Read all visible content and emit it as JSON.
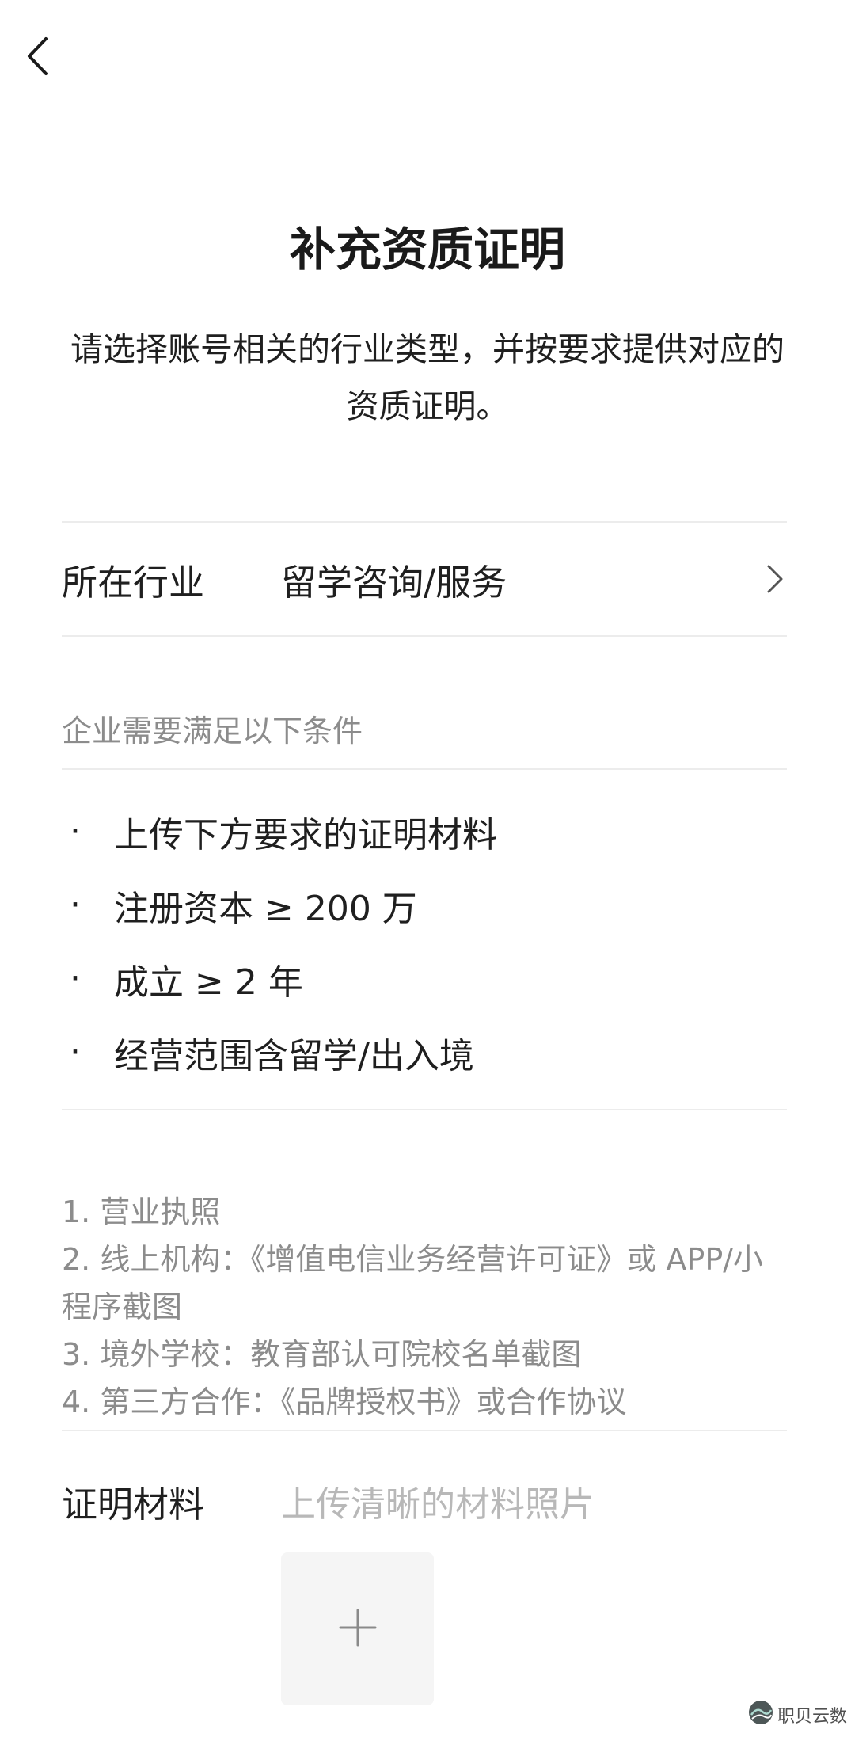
{
  "header": {
    "back_icon": "chevron-left-icon"
  },
  "page": {
    "title": "补充资质证明",
    "description": "请选择账号相关的行业类型，并按要求提供对应的资质证明。"
  },
  "industry": {
    "label": "所在行业",
    "value": "留学咨询/服务",
    "icon": "chevron-right-icon"
  },
  "conditions": {
    "header": "企业需要满足以下条件",
    "bullet": "·",
    "items": [
      "上传下方要求的证明材料",
      "注册资本 ≥ 200 万",
      "成立 ≥ 2 年",
      "经营范围含留学/出入境"
    ]
  },
  "documents": {
    "items": [
      "1. 营业执照",
      "2. 线上机构：《增值电信业务经营许可证》或 APP/小程序截图",
      "3. 境外学校：教育部认可院校名单截图",
      "4. 第三方合作：《品牌授权书》或合作协议"
    ]
  },
  "proof": {
    "label": "证明材料",
    "placeholder": "上传清晰的材料照片",
    "upload_icon": "plus-icon"
  },
  "watermark": {
    "text": "职贝云数"
  },
  "colors": {
    "text_primary": "#1f1f1f",
    "text_secondary": "#8c8c8c",
    "placeholder": "#b8b8b8",
    "divider": "#ececec",
    "upload_bg": "#f5f5f5"
  }
}
